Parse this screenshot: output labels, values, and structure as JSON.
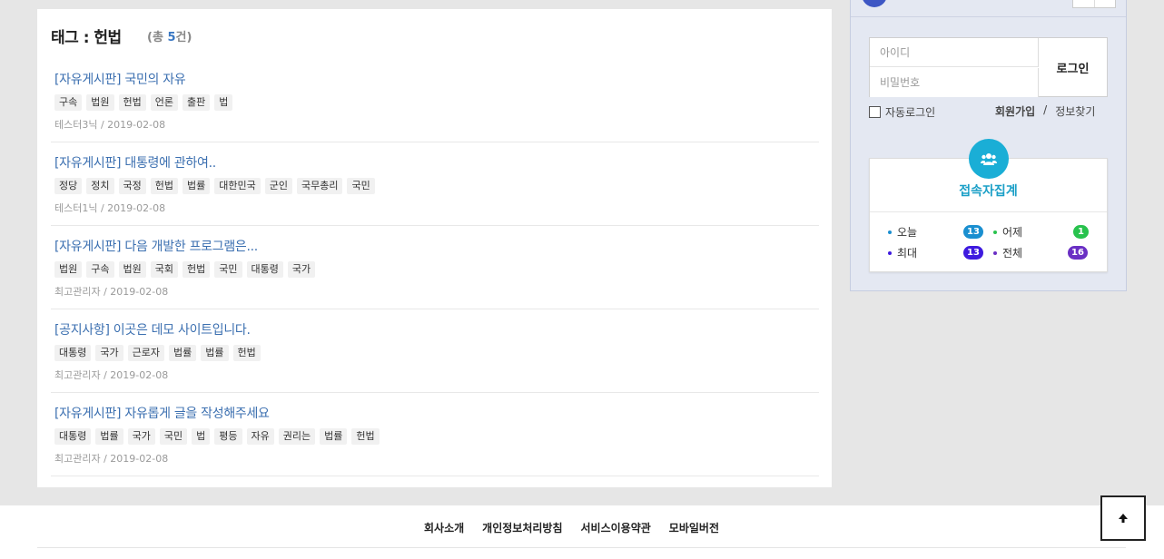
{
  "page": {
    "title": "태그 : 헌법",
    "count_prefix": "(총 ",
    "count_num": "5",
    "count_suffix": "건)"
  },
  "posts": [
    {
      "title": "[자유게시판] 국민의 자유",
      "tags": [
        "구속",
        "법원",
        "헌법",
        "언론",
        "출판",
        "법"
      ],
      "meta": "테스터3닉 / 2019-02-08"
    },
    {
      "title": "[자유게시판] 대통령에 관하여..",
      "tags": [
        "정당",
        "정치",
        "국정",
        "헌법",
        "법률",
        "대한민국",
        "군인",
        "국무총리",
        "국민"
      ],
      "meta": "테스터1닉 / 2019-02-08"
    },
    {
      "title": "[자유게시판] 다음 개발한 프로그램은...",
      "tags": [
        "법원",
        "구속",
        "법원",
        "국회",
        "헌법",
        "국민",
        "대통령",
        "국가"
      ],
      "meta": "최고관리자 / 2019-02-08"
    },
    {
      "title": "[공지사항] 이곳은 데모 사이트입니다.",
      "tags": [
        "대통령",
        "국가",
        "근로자",
        "법률",
        "법률",
        "헌법"
      ],
      "meta": "최고관리자 / 2019-02-08"
    },
    {
      "title": "[자유게시판] 자유롭게 글을 작성해주세요",
      "tags": [
        "대통령",
        "법률",
        "국가",
        "국민",
        "법",
        "평등",
        "자유",
        "권리는",
        "법률",
        "헌법"
      ],
      "meta": "최고관리자 / 2019-02-08"
    }
  ],
  "login": {
    "id_placeholder": "아이디",
    "pw_placeholder": "비밀번호",
    "button": "로그인",
    "auto_login": "자동로그인",
    "join": "회원가입",
    "separator": "/",
    "find": "정보찾기"
  },
  "stats": {
    "title": "접속자집계",
    "today_label": "오늘",
    "today_value": "13",
    "yesterday_label": "어제",
    "yesterday_value": "1",
    "max_label": "최대",
    "max_value": "13",
    "total_label": "전체",
    "total_value": "16"
  },
  "colors": {
    "accent": "#1aaed6",
    "link": "#3b6fb0",
    "badge_today": "#1a8fd0",
    "badge_yesterday": "#28c24d",
    "badge_max": "#3e1adf",
    "badge_total": "#6a2fc4"
  },
  "footer": {
    "links": [
      "회사소개",
      "개인정보처리방침",
      "서비스이용약관",
      "모바일버전"
    ],
    "top_icon": "arrow-up-icon"
  }
}
